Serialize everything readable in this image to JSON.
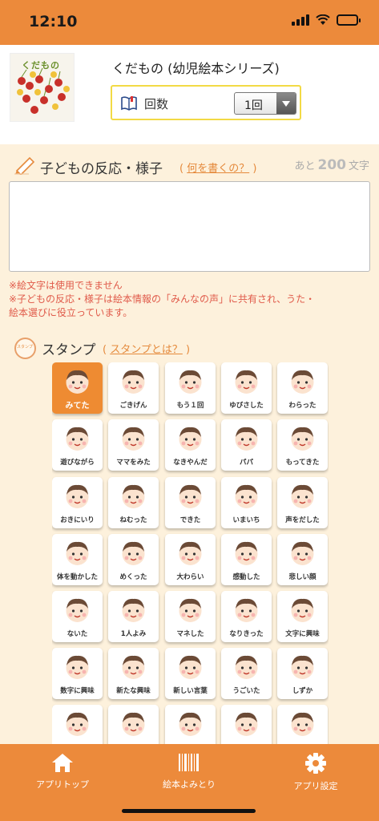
{
  "status": {
    "time": "12:10"
  },
  "book": {
    "cover_title": "くだもの",
    "title": "くだもの (幼児絵本シリーズ)"
  },
  "count": {
    "label": "回数",
    "selected": "1回"
  },
  "reaction": {
    "title": "子どもの反応・様子",
    "help_paren_open": "(",
    "help_link": "何を書くの？",
    "help_paren_close": ")",
    "counter_prefix": "あと",
    "counter_value": "200",
    "counter_suffix": "文字",
    "notes": [
      "※絵文字は使用できません",
      "※子どもの反応・様子は絵本情報の「みんなの声」に共有され、うた・",
      "絵本選びに役立っています。"
    ]
  },
  "stamp_section": {
    "title": "スタンプ",
    "help_paren_open": "(",
    "help_link": "スタンプとは？",
    "help_paren_close": ")"
  },
  "stamps": [
    {
      "label": "みてた",
      "selected": true
    },
    {
      "label": "ごきげん"
    },
    {
      "label": "もう１回"
    },
    {
      "label": "ゆびさした"
    },
    {
      "label": "わらった"
    },
    {
      "label": "遊びながら"
    },
    {
      "label": "ママをみた"
    },
    {
      "label": "なきやんだ"
    },
    {
      "label": "パパ"
    },
    {
      "label": "もってきた"
    },
    {
      "label": "おきにいり"
    },
    {
      "label": "ねむった"
    },
    {
      "label": "できた"
    },
    {
      "label": "いまいち"
    },
    {
      "label": "声をだした"
    },
    {
      "label": "体を動かした"
    },
    {
      "label": "めくった"
    },
    {
      "label": "大わらい"
    },
    {
      "label": "感動した"
    },
    {
      "label": "悲しい顔"
    },
    {
      "label": "ないた"
    },
    {
      "label": "1人よみ"
    },
    {
      "label": "マネした"
    },
    {
      "label": "なりきった"
    },
    {
      "label": "文字に興味"
    },
    {
      "label": "数字に興味"
    },
    {
      "label": "新たな興味"
    },
    {
      "label": "新しい言葉"
    },
    {
      "label": "うごいた"
    },
    {
      "label": "しずか"
    },
    {
      "label": ""
    },
    {
      "label": ""
    },
    {
      "label": ""
    },
    {
      "label": ""
    },
    {
      "label": ""
    }
  ],
  "nav": [
    {
      "label": "アプリトップ",
      "icon": "home-icon"
    },
    {
      "label": "絵本よみとり",
      "icon": "barcode-icon"
    },
    {
      "label": "アプリ設定",
      "icon": "gear-icon"
    }
  ],
  "colors": {
    "accent": "#ec8a3b",
    "background": "#fdf1dc",
    "link": "#e58a3c",
    "warning": "#e05a4a",
    "highlight_border": "#f2da45"
  }
}
